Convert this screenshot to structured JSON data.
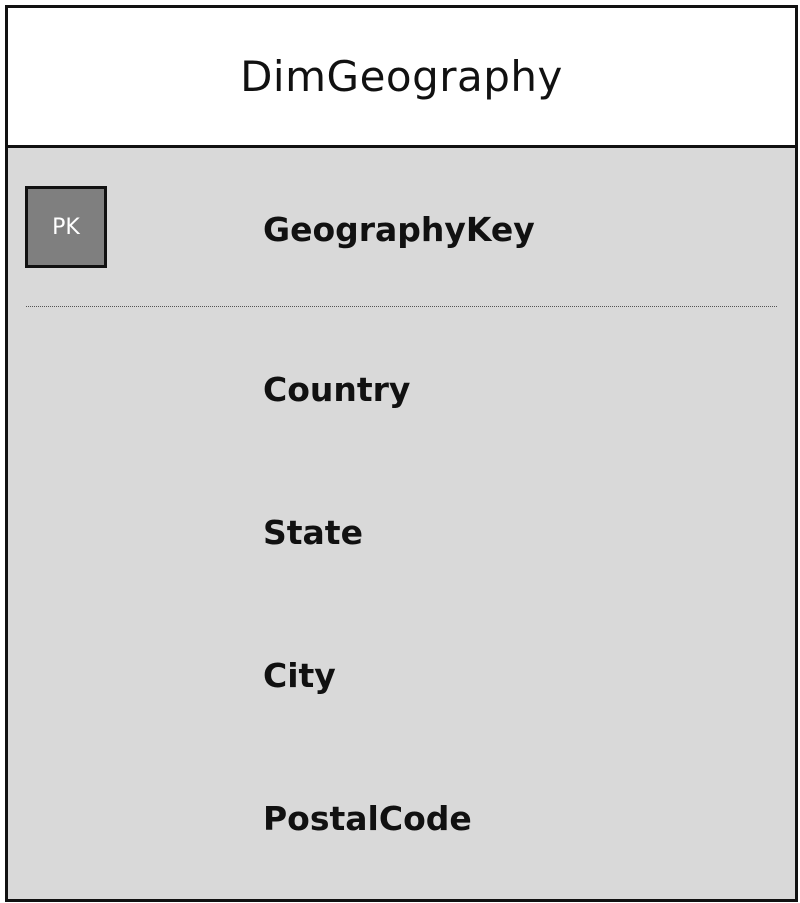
{
  "entity": {
    "title": "DimGeography",
    "primary_key": {
      "badge": "PK",
      "field": "GeographyKey"
    },
    "fields": [
      "Country",
      "State",
      "City",
      "PostalCode"
    ]
  },
  "colors": {
    "header_bg": "#ffffff",
    "body_bg": "#d9d9d9",
    "pk_badge_bg": "#7f7f7f",
    "border": "#111111"
  }
}
